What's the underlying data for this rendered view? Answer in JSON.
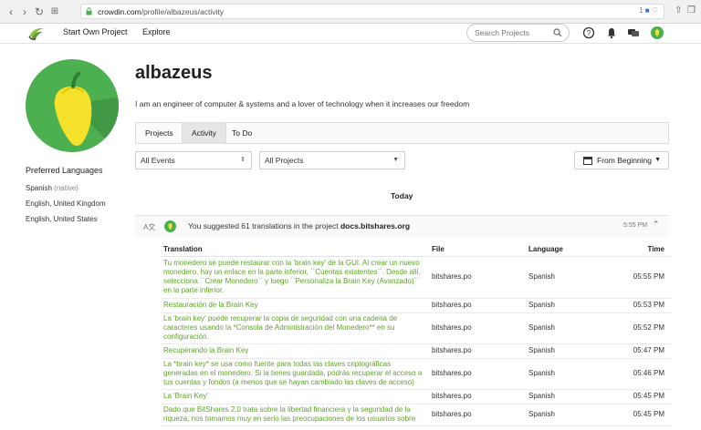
{
  "browser": {
    "url_domain": "crowdin.com",
    "url_path": "/profile/albazeus/activity",
    "tab_count": "1"
  },
  "header": {
    "start_project": "Start Own Project",
    "explore": "Explore",
    "search_placeholder": "Search Projects"
  },
  "profile": {
    "username": "albazeus",
    "bio": "I am an engineer of computer & systems and a lover of technology when it increases our freedom",
    "preferred_languages_title": "Preferred Languages",
    "languages": [
      {
        "name": "Spanish",
        "note": "(native)"
      },
      {
        "name": "English, United Kingdom",
        "note": ""
      },
      {
        "name": "English, United States",
        "note": ""
      }
    ]
  },
  "tabs": [
    {
      "label": "Projects"
    },
    {
      "label": "Activity",
      "active": true
    },
    {
      "label": "To Do"
    }
  ],
  "filters": {
    "events": "All Events",
    "projects": "All Projects",
    "date": "From Beginning"
  },
  "day_label": "Today",
  "activity": {
    "text_prefix": "You suggested 61 translations in the project ",
    "project": "docs.bitshares.org",
    "time": "5:55 PM"
  },
  "table": {
    "headers": {
      "translation": "Translation",
      "file": "File",
      "language": "Language",
      "time": "Time"
    },
    "rows": [
      {
        "text": "Tu monedero se puede restaurar con la 'brain key' de la GUI. Al crear un nuevo monedero, hay un enlace en la parte inferior, ``Cuentas existentes``. Desde allí, selecciona ``Crear Monedero`` y luego ``Personaliza la Brain Key (Avanzado)`` en la parte inferior.",
        "file": "bitshares.po",
        "language": "Spanish",
        "time": "05:55 PM"
      },
      {
        "text": "Restauración de la Brain Key",
        "file": "bitshares.po",
        "language": "Spanish",
        "time": "05:53 PM"
      },
      {
        "text": "La 'brain key' puede recuperar la copia de seguridad con una cadena de caracteres usando la *Consola de Administración del Monedero** en su configuración.",
        "file": "bitshares.po",
        "language": "Spanish",
        "time": "05:52 PM"
      },
      {
        "text": "Recuperando la Brain Key",
        "file": "bitshares.po",
        "language": "Spanish",
        "time": "05:47 PM"
      },
      {
        "text": "La *brain key* se usa como fuente para todas las claves criptográficas generadas en el monedero. Si la tienes guardada, podrás recuperar el acceso a tus cuentas y fondos (a menos que se hayan cambiado las claves de acceso)",
        "file": "bitshares.po",
        "language": "Spanish",
        "time": "05:46 PM"
      },
      {
        "text": "La 'Brain Key'",
        "file": "bitshares.po",
        "language": "Spanish",
        "time": "05:45 PM"
      },
      {
        "text": "Dado que BitShares 2.0 trata sobre la libertad financiera y la seguridad de la riqueza, nos tomamos muy en serio las preocupaciones de los usuarios sobre",
        "file": "bitshares.po",
        "language": "Spanish",
        "time": "05:45 PM"
      }
    ]
  }
}
